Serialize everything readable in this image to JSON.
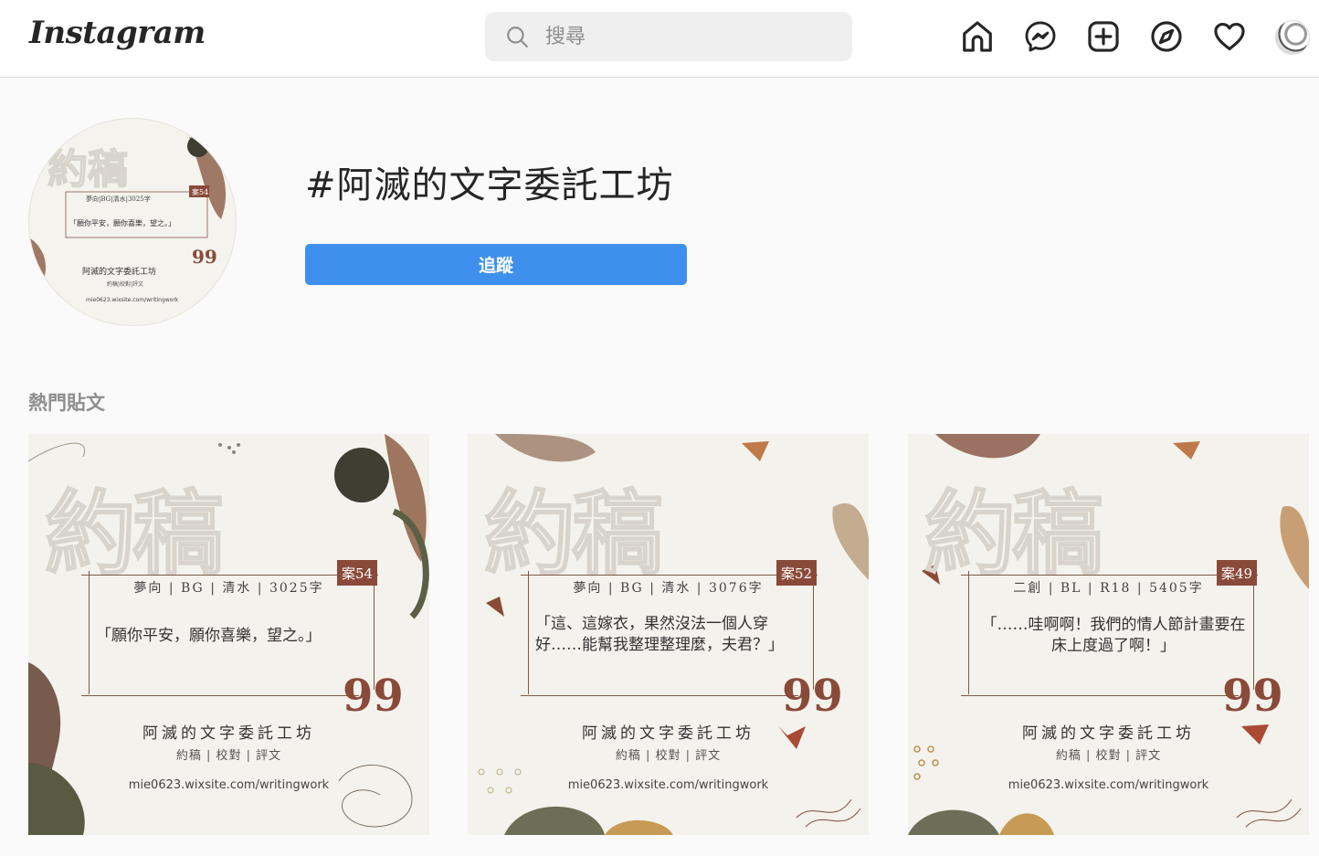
{
  "header": {
    "logo": "Instagram",
    "search_placeholder": "搜尋",
    "nav": [
      "home-icon",
      "messenger-icon",
      "new-post-icon",
      "explore-icon",
      "activity-heart-icon",
      "profile-avatar"
    ]
  },
  "tag": {
    "title": "#阿滅的文字委託工坊",
    "follow_label": "追蹤"
  },
  "section": {
    "title": "熱門貼文"
  },
  "posts": [
    {
      "watermark": "約稿",
      "badge": "案54",
      "meta": "夢向 | BG | 清水 | 3025字",
      "quote": "「願你平安，願你喜樂，望之。」",
      "qmark": "99",
      "studio": "阿滅的文字委託工坊",
      "services": "約稿 | 校對 | 評文",
      "url": "mie0623.wixsite.com/writingwork"
    },
    {
      "watermark": "約稿",
      "badge": "案52",
      "meta": "夢向 | BG | 清水 | 3076字",
      "quote": "「這、這嫁衣，果然沒法一個人穿好……能幫我整理整理麼，夫君？」",
      "qmark": "99",
      "studio": "阿滅的文字委託工坊",
      "services": "約稿 | 校對 | 評文",
      "url": "mie0623.wixsite.com/writingwork"
    },
    {
      "watermark": "約稿",
      "badge": "案49",
      "meta": "二創 | BL | R18 | 5405字",
      "quote": "「……哇啊啊！我們的情人節計畫要在床上度過了啊！」",
      "qmark": "99",
      "studio": "阿滅的文字委託工坊",
      "services": "約稿 | 校對 | 評文",
      "url": "mie0623.wixsite.com/writingwork"
    }
  ],
  "colors": {
    "follow_button": "#3e90ec",
    "accent_brown": "#8a4a3a"
  }
}
